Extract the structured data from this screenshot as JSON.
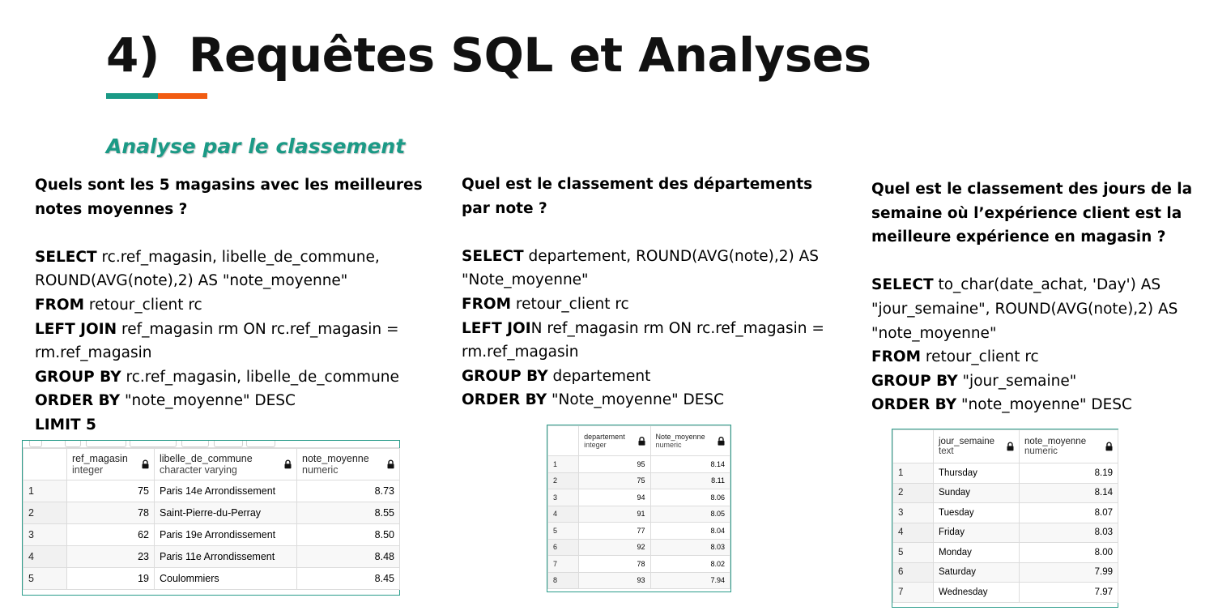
{
  "header": {
    "number": "4)",
    "title": "Requêtes SQL et Analyses",
    "subtitle": "Analyse par le classement",
    "accent_colors": [
      "#1b9a86",
      "#f15c12"
    ]
  },
  "analysis1": {
    "question": "Quels sont les 5 magasins avec les meilleures notes moyennes ?",
    "sql_lines": [
      {
        "kw": "SELECT",
        "text": " rc.ref_magasin, libelle_de_commune, ROUND(AVG(note),2) AS \"note_moyenne\""
      },
      {
        "kw": "FROM",
        "text": " retour_client rc"
      },
      {
        "kw": "LEFT JOIN",
        "text": " ref_magasin rm ON rc.ref_magasin = rm.ref_magasin"
      },
      {
        "kw": "GROUP BY",
        "text": " rc.ref_magasin, libelle_de_commune"
      },
      {
        "kw": "ORDER BY",
        "text": " \"note_moyenne\" DESC"
      },
      {
        "kw": "LIMIT 5",
        "text": ""
      }
    ],
    "table": {
      "columns": [
        {
          "name": "ref_magasin",
          "type": "integer"
        },
        {
          "name": "libelle_de_commune",
          "type": "character varying"
        },
        {
          "name": "note_moyenne",
          "type": "numeric"
        }
      ],
      "rows": [
        [
          "1",
          "75",
          "Paris 14e Arrondissement",
          "8.73"
        ],
        [
          "2",
          "78",
          "Saint-Pierre-du-Perray",
          "8.55"
        ],
        [
          "3",
          "62",
          "Paris 19e Arrondissement",
          "8.50"
        ],
        [
          "4",
          "23",
          "Paris 11e Arrondissement",
          "8.48"
        ],
        [
          "5",
          "19",
          "Coulommiers",
          "8.45"
        ]
      ]
    }
  },
  "analysis2": {
    "question": "Quel est le classement des départements par note ?",
    "sql_lines": [
      {
        "kw": "SELECT",
        "text": " departement, ROUND(AVG(note),2) AS \"Note_moyenne\""
      },
      {
        "kw": "FROM",
        "text": " retour_client rc"
      },
      {
        "kw": "LEFT JOI",
        "text": "N ref_magasin rm ON rc.ref_magasin = rm.ref_magasin"
      },
      {
        "kw": "GROUP BY",
        "text": " departement"
      },
      {
        "kw": "ORDER BY",
        "text": " \"Note_moyenne\" DESC"
      }
    ],
    "table": {
      "columns": [
        {
          "name": "departement",
          "type": "integer"
        },
        {
          "name": "Note_moyenne",
          "type": "numeric"
        }
      ],
      "rows": [
        [
          "1",
          "95",
          "8.14"
        ],
        [
          "2",
          "75",
          "8.11"
        ],
        [
          "3",
          "94",
          "8.06"
        ],
        [
          "4",
          "91",
          "8.05"
        ],
        [
          "5",
          "77",
          "8.04"
        ],
        [
          "6",
          "92",
          "8.03"
        ],
        [
          "7",
          "78",
          "8.02"
        ],
        [
          "8",
          "93",
          "7.94"
        ]
      ]
    }
  },
  "analysis3": {
    "question": "Quel est le classement des jours de la semaine où l’expérience client est la meilleure expérience en magasin ?",
    "sql_lines": [
      {
        "kw": "SELECT",
        "text": " to_char(date_achat, 'Day') AS \"jour_semaine\", ROUND(AVG(note),2) AS \"note_moyenne\""
      },
      {
        "kw": "FROM",
        "text": " retour_client rc"
      },
      {
        "kw": "GROUP BY",
        "text": " \"jour_semaine\""
      },
      {
        "kw": "ORDER BY",
        "text": " \"note_moyenne\" DESC"
      }
    ],
    "table": {
      "columns": [
        {
          "name": "jour_semaine",
          "type": "text"
        },
        {
          "name": "note_moyenne",
          "type": "numeric"
        }
      ],
      "rows": [
        [
          "1",
          "Thursday",
          "8.19"
        ],
        [
          "2",
          "Sunday",
          "8.14"
        ],
        [
          "3",
          "Tuesday",
          "8.07"
        ],
        [
          "4",
          "Friday",
          "8.03"
        ],
        [
          "5",
          "Monday",
          "8.00"
        ],
        [
          "6",
          "Saturday",
          "7.99"
        ],
        [
          "7",
          "Wednesday",
          "7.97"
        ]
      ]
    }
  }
}
